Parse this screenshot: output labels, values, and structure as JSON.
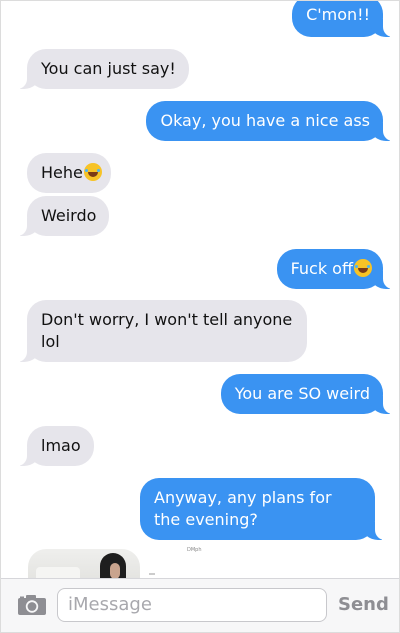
{
  "conversation": {
    "messages": [
      {
        "direction": "out",
        "text": "C'mon!!"
      },
      {
        "direction": "in",
        "text": "You can just say!"
      },
      {
        "direction": "out",
        "text": "Okay, you have a nice ass"
      },
      {
        "direction": "in",
        "text": "Hehe",
        "emoji": "face-with-tears-of-joy"
      },
      {
        "direction": "in",
        "text": "Weirdo"
      },
      {
        "direction": "out",
        "text": "Fuck off",
        "emoji": "face-with-tears-of-joy"
      },
      {
        "direction": "in",
        "text": "Don't worry, I won't tell anyone lol"
      },
      {
        "direction": "out",
        "text": "You are SO weird"
      },
      {
        "direction": "in",
        "text": "lmao"
      },
      {
        "direction": "out",
        "text": "Anyway, any plans for the evening?"
      }
    ],
    "attachment": {
      "type": "photo",
      "caption_fragment": "DMph"
    }
  },
  "input_bar": {
    "camera_icon": "camera-icon",
    "placeholder": "iMessage",
    "send_label": "Send"
  },
  "colors": {
    "outgoing_bubble": "#3a93f2",
    "incoming_bubble": "#e6e5eb",
    "send_label": "#8e8e93"
  }
}
